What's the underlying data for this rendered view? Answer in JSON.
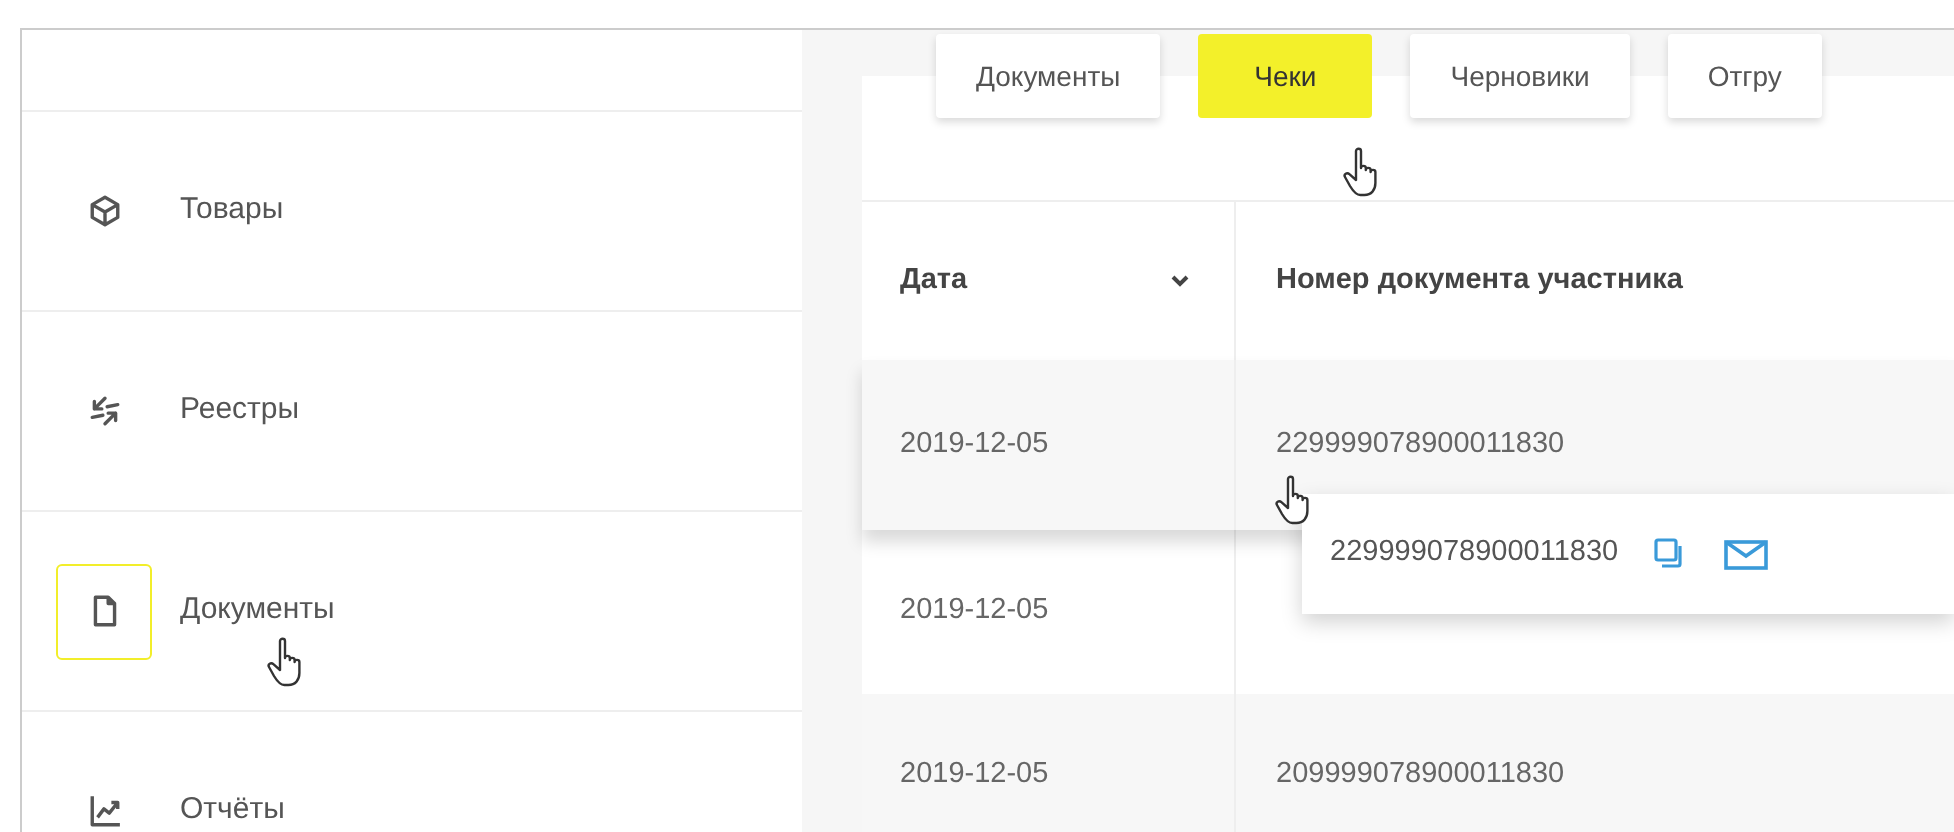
{
  "sidebar": {
    "items": [
      {
        "label": "Товары",
        "kind": "goods",
        "selected": false
      },
      {
        "label": "Реестры",
        "kind": "registries",
        "selected": false
      },
      {
        "label": "Документы",
        "kind": "documents",
        "selected": true
      },
      {
        "label": "Отчёты",
        "kind": "reports",
        "selected": false
      }
    ]
  },
  "tabs": [
    {
      "label": "Документы",
      "selected": false
    },
    {
      "label": "Чеки",
      "selected": true
    },
    {
      "label": "Черновики",
      "selected": false
    },
    {
      "label": "Отгру",
      "selected": false
    }
  ],
  "table": {
    "columns": [
      {
        "label": "Дата",
        "sorted": true
      },
      {
        "label": "Номер документа участника",
        "sorted": false
      }
    ],
    "rows": [
      {
        "date": "2019-12-05",
        "number": "229999078900011830",
        "hovered": true
      },
      {
        "date": "2019-12-05",
        "hovered": false
      },
      {
        "date": "2019-12-05",
        "number": "209999078900011830",
        "hovered": false
      }
    ]
  },
  "popover": {
    "text": "229999078900011830"
  }
}
